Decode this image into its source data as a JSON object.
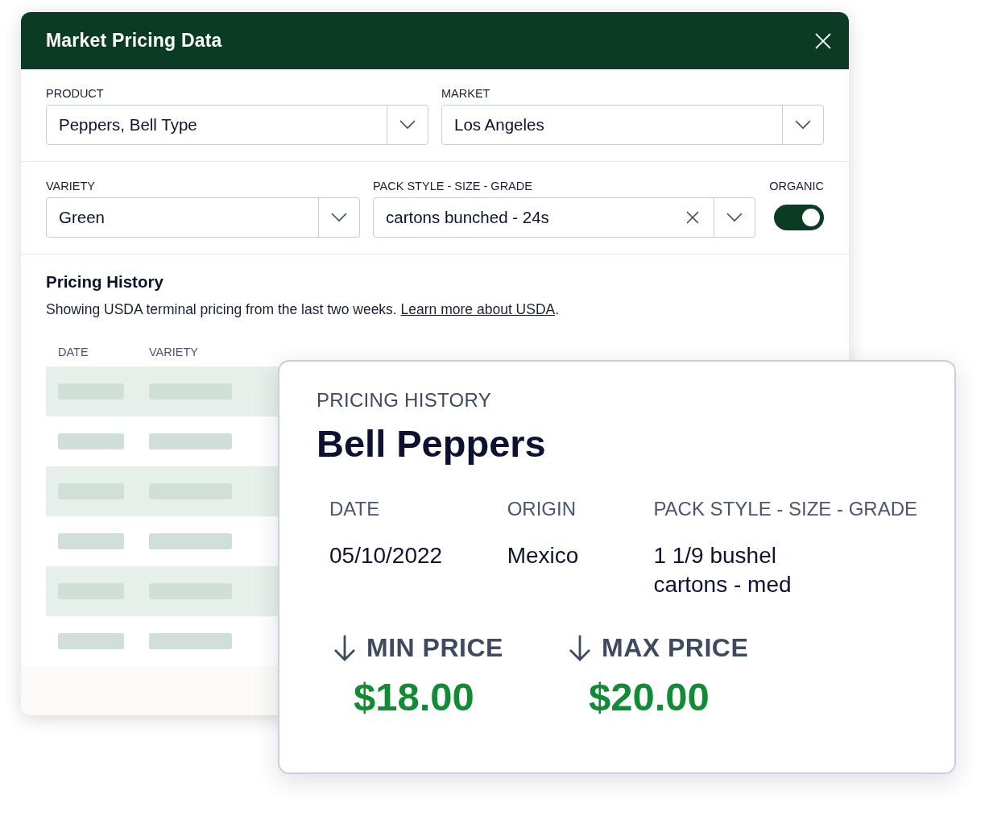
{
  "window": {
    "title": "Market Pricing Data"
  },
  "filter_rows": [
    {
      "fields": [
        {
          "kind": "select",
          "label": "PRODUCT",
          "value": "Peppers, Bell Type"
        },
        {
          "kind": "select",
          "label": "MARKET",
          "value": "Los Angeles"
        }
      ]
    },
    {
      "fields": [
        {
          "kind": "select",
          "label": "VARIETY",
          "value": "Green"
        },
        {
          "kind": "clearable",
          "label": "PACK STYLE - SIZE - GRADE",
          "value": "cartons bunched - 24s"
        },
        {
          "kind": "toggle",
          "label": "ORGANIC",
          "on": true
        }
      ]
    }
  ],
  "pricing_history": {
    "title": "Pricing History",
    "description": "Showing USDA terminal pricing from the last two weeks. ",
    "link": "Learn more about USDA",
    "after_link": "."
  },
  "table": {
    "columns": [
      "DATE",
      "VARIETY"
    ],
    "rows": [
      {
        "kind": "skeleton"
      },
      {
        "kind": "skeleton"
      },
      {
        "kind": "skeleton"
      },
      {
        "kind": "skeleton"
      },
      {
        "kind": "skeleton"
      },
      {
        "kind": "skeleton"
      }
    ]
  },
  "detail_card": {
    "eyebrow": "PRICING HISTORY",
    "title": "Bell Peppers",
    "details": [
      {
        "label": "DATE",
        "value": "05/10/2022"
      },
      {
        "label": "ORIGIN",
        "value": "Mexico"
      },
      {
        "label": "PACK STYLE - SIZE - GRADE",
        "value": "1 1/9 bushel cartons - med"
      }
    ],
    "prices": [
      {
        "label": "MIN PRICE",
        "value": "$18.00",
        "kind": "falling"
      },
      {
        "label": "MAX PRICE",
        "value": "$20.00",
        "kind": "falling"
      }
    ]
  }
}
